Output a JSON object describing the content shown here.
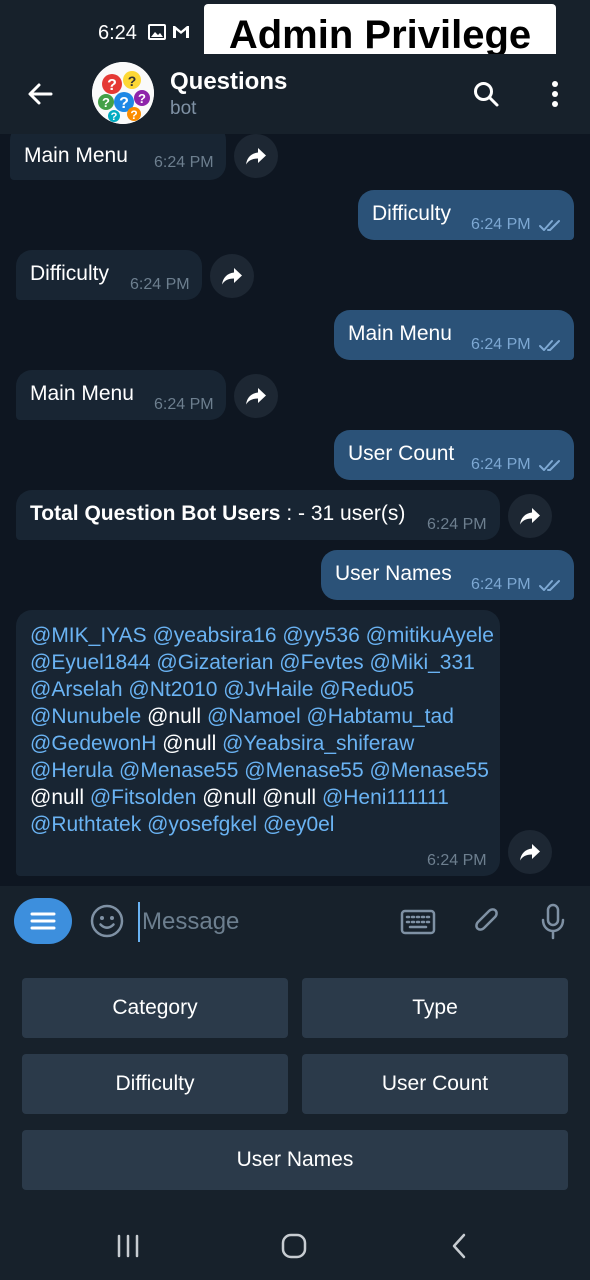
{
  "status_bar": {
    "time": "6:24"
  },
  "overlay": {
    "label": "Admin Privilege"
  },
  "header": {
    "title": "Questions",
    "subtitle": "bot"
  },
  "messages": [
    {
      "text": "Main Menu",
      "time": "6:24 PM"
    },
    {
      "text": "Difficulty",
      "time": "6:24 PM"
    },
    {
      "text": "Difficulty",
      "time": "6:24 PM"
    },
    {
      "text": "Main Menu",
      "time": "6:24 PM"
    },
    {
      "text": "Main Menu",
      "time": "6:24 PM"
    },
    {
      "text": "User Count",
      "time": "6:24 PM"
    },
    {
      "bold": "Total Question Bot Users",
      "text": " : - 31 user(s)",
      "time": "6:24 PM"
    },
    {
      "text": "User Names",
      "time": "6:24 PM"
    },
    {
      "time": "6:24 PM",
      "users": [
        "@MIK_IYAS",
        "@yeabsira16",
        "@yy536",
        "@mitikuAyele",
        "@Eyuel1844",
        "@Gizaterian",
        "@Fevtes",
        "@Miki_331",
        "@Arselah",
        "@Nt2010",
        "@JvHaile",
        "@Redu05",
        "@Nunubele",
        "@null",
        "@Namoel",
        "@Habtamu_tad",
        "@GedewonH",
        "@null",
        "@Yeabsira_shiferaw",
        "@Herula",
        "@Menase55",
        "@Menase55",
        "@Menase55",
        "@null",
        "@Fitsolden",
        "@null",
        "@null",
        "@Heni111111",
        "@Ruthtatek",
        "@yosefgkel",
        "@ey0el"
      ]
    }
  ],
  "input": {
    "placeholder": "Message"
  },
  "keyboard": {
    "category": "Category",
    "type": "Type",
    "difficulty": "Difficulty",
    "user_count": "User Count",
    "user_names": "User Names"
  },
  "colors": {
    "background": "#0e1621",
    "bar": "#17212b",
    "incoming": "#182533",
    "outgoing": "#2b5278",
    "mention": "#6ab3f3",
    "accent": "#3d8fdd"
  },
  "icons": [
    "back-arrow-icon",
    "search-icon",
    "more-vert-icon",
    "share-icon",
    "double-check-icon",
    "menu-icon",
    "emoji-icon",
    "keyboard-icon",
    "paperclip-icon",
    "microphone-icon"
  ]
}
